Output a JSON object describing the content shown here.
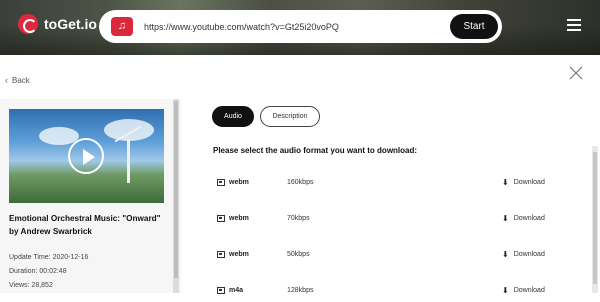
{
  "header": {
    "logo_text": "toGet.io",
    "url_value": "https://www.youtube.com/watch?v=Gt25i20voPQ",
    "start_label": "Start"
  },
  "nav": {
    "back_label": "Back"
  },
  "video": {
    "title": "Emotional Orchestral Music: \"Onward\" by Andrew Swarbrick",
    "update_time": "Update Time: 2020-12-16",
    "duration": "Duration: 00:02:48",
    "views": "Views: 28,852"
  },
  "tabs": {
    "audio": "Audio",
    "description": "Description"
  },
  "prompt": "Please select the audio format you want to download:",
  "formats": [
    {
      "format": "webm",
      "quality": "160kbps",
      "action": "Download"
    },
    {
      "format": "webm",
      "quality": "70kbps",
      "action": "Download"
    },
    {
      "format": "webm",
      "quality": "50kbps",
      "action": "Download"
    },
    {
      "format": "m4a",
      "quality": "128kbps",
      "action": "Download"
    }
  ],
  "colors": {
    "accent": "#d9293a",
    "dark_button": "#111111"
  }
}
